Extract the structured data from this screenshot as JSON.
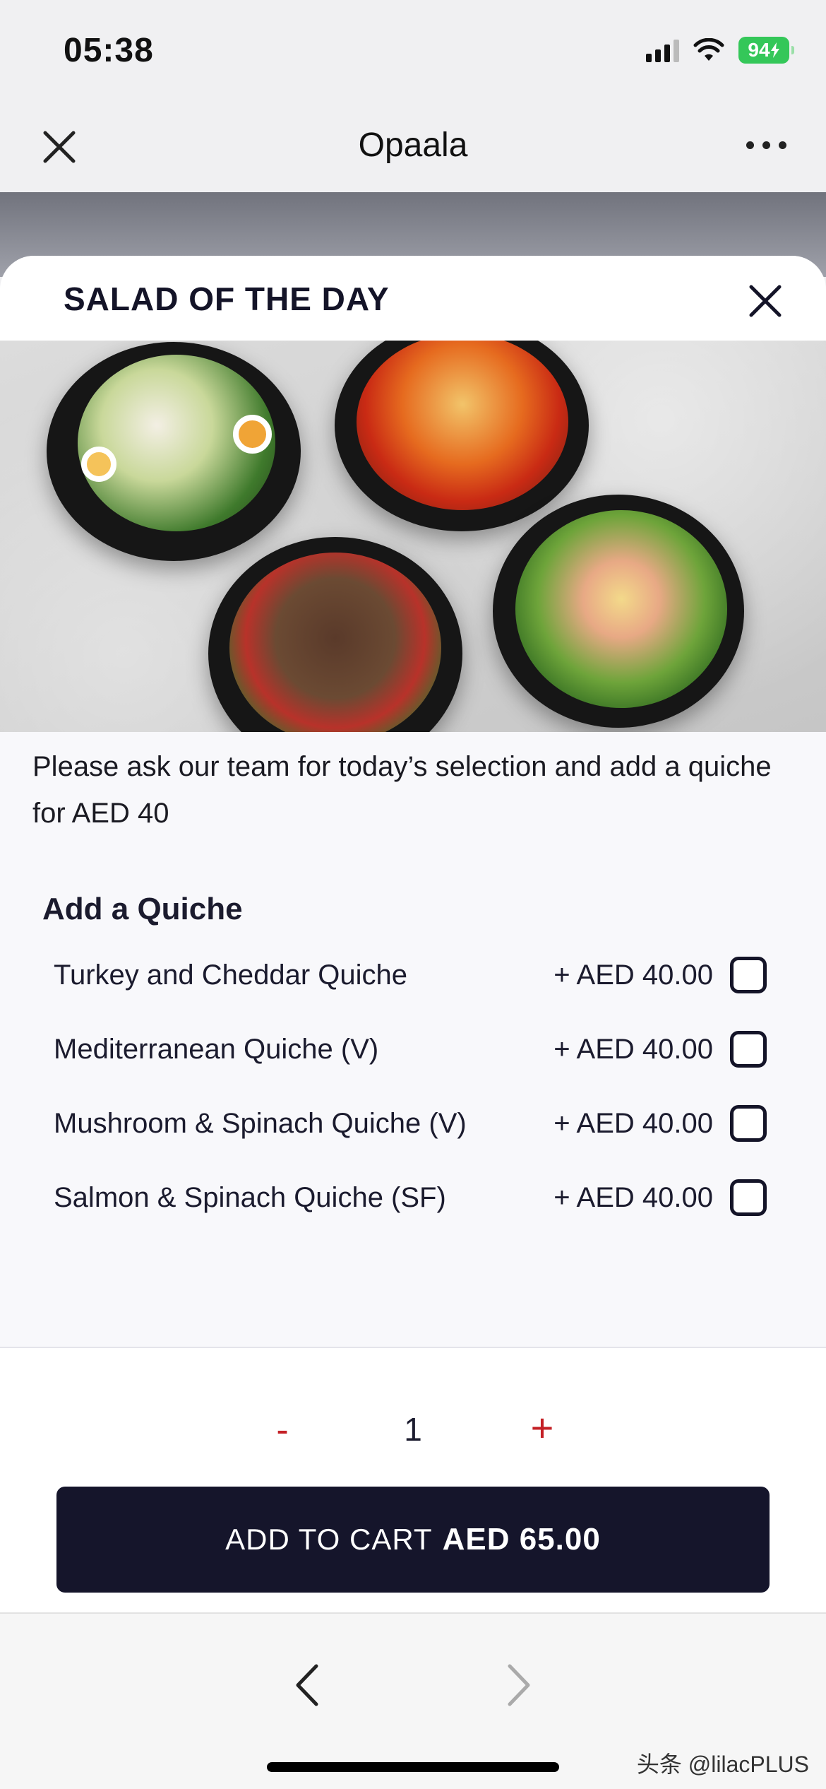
{
  "status_bar": {
    "time": "05:38",
    "battery": "94",
    "icons": [
      "signal-icon",
      "wifi-icon",
      "battery-charging-icon"
    ]
  },
  "nav": {
    "title": "Opaala",
    "close_icon": "close-icon",
    "more_icon": "more-horizontal-icon"
  },
  "modal": {
    "title": "SALAD OF THE DAY",
    "close_icon": "close-icon",
    "description": "Please ask our team for today’s selection and add a quiche for AED 40"
  },
  "quiche_section": {
    "title": "Add a Quiche",
    "options": [
      {
        "name": "Turkey and Cheddar Quiche",
        "price": "+ AED 40.00",
        "checked": false
      },
      {
        "name": "Mediterranean Quiche (V)",
        "price": "+ AED 40.00",
        "checked": false
      },
      {
        "name": "Mushroom & Spinach Quiche (V)",
        "price": "+ AED 40.00",
        "checked": false
      },
      {
        "name": "Salmon & Spinach Quiche (SF)",
        "price": "+ AED 40.00",
        "checked": false
      }
    ]
  },
  "quantity": {
    "minus_label": "-",
    "value": "1",
    "plus_label": "+"
  },
  "cart_button": {
    "label": "ADD TO CART",
    "price": "AED 65.00"
  },
  "browser_bar": {
    "back_icon": "chevron-left-icon",
    "forward_icon": "chevron-right-icon"
  },
  "watermark": "头条 @lilacPLUS",
  "colors": {
    "accent_red": "#c42026",
    "navy": "#15152b",
    "battery_green": "#34c759"
  }
}
